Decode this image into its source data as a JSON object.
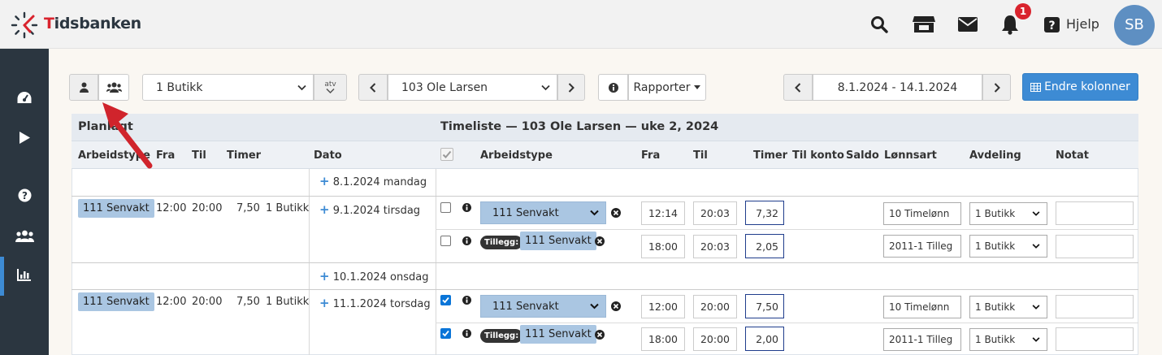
{
  "app": {
    "brand": "Tidsbanken",
    "help_label": "Hjelp",
    "notification_count": "1",
    "avatar_initials": "SB"
  },
  "toolbar": {
    "store_select": "1 Butikk",
    "atv_label": "atv",
    "employee_select": "103 Ole Larsen",
    "reports_label": "Rapporter",
    "date_range": "8.1.2024 - 14.1.2024",
    "change_columns_label": "Endre kolonner"
  },
  "table": {
    "planned_title": "Planlagt",
    "timesheet_title": "Timeliste — 103 Ole Larsen — uke 2, 2024",
    "planned_headers": {
      "worktype": "Arbeidstype",
      "from": "Fra",
      "to": "Til",
      "hours": "Timer",
      "date": "Dato"
    },
    "timesheet_headers": {
      "worktype": "Arbeidstype",
      "from": "Fra",
      "to": "Til",
      "hours": "Timer",
      "to_account": "Til konto",
      "balance": "Saldo",
      "wage_type": "Lønnsart",
      "department": "Avdeling",
      "note": "Notat"
    },
    "tillegg_label": "Tillegg:",
    "days": [
      {
        "date": "8.1.2024 mandag"
      },
      {
        "date": "9.1.2024 tirsdag",
        "planned": {
          "worktype": "111 Senvakt",
          "from": "12:00",
          "to": "20:00",
          "hours": "7,50",
          "dept": "1 Butikk"
        },
        "entries": [
          {
            "checked": false,
            "tillegg": false,
            "worktype": "111 Senvakt",
            "from": "12:14",
            "to": "20:03",
            "hours": "7,32",
            "wage": "10 Timelønn",
            "dept": "1 Butikk"
          },
          {
            "checked": false,
            "tillegg": true,
            "worktype": "111 Senvakt",
            "from": "18:00",
            "to": "20:03",
            "hours": "2,05",
            "wage": "2011-1 Tilleg",
            "dept": "1 Butikk"
          }
        ]
      },
      {
        "date": "10.1.2024 onsdag"
      },
      {
        "date": "11.1.2024 torsdag",
        "planned": {
          "worktype": "111 Senvakt",
          "from": "12:00",
          "to": "20:00",
          "hours": "7,50",
          "dept": "1 Butikk"
        },
        "entries": [
          {
            "checked": true,
            "tillegg": false,
            "worktype": "111 Senvakt",
            "from": "12:00",
            "to": "20:00",
            "hours": "7,50",
            "wage": "10 Timelønn",
            "dept": "1 Butikk"
          },
          {
            "checked": true,
            "tillegg": true,
            "worktype": "111 Senvakt",
            "from": "18:00",
            "to": "20:00",
            "hours": "2,00",
            "wage": "2011-1 Tilleg",
            "dept": "1 Butikk"
          }
        ]
      }
    ]
  },
  "colors": {
    "sidebar": "#2b3640",
    "accent": "#3d8bd4",
    "tag": "#aac6e2",
    "badge": "#d9232d",
    "arrow": "#d0242c"
  }
}
